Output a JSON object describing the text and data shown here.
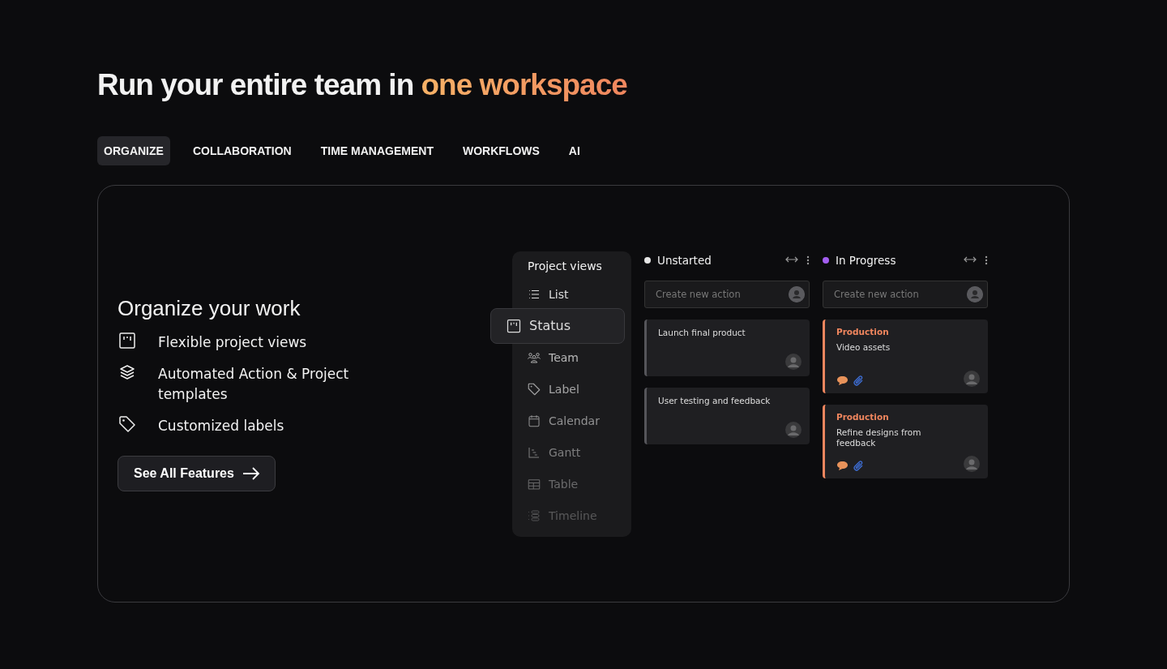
{
  "heading": {
    "text": "Run your entire team in",
    "highlight": "one workspace"
  },
  "tabs": [
    {
      "label": "ORGANIZE",
      "selected": true
    },
    {
      "label": "COLLABORATION",
      "selected": false
    },
    {
      "label": "TIME MANAGEMENT",
      "selected": false
    },
    {
      "label": "WORKFLOWS",
      "selected": false
    },
    {
      "label": "AI",
      "selected": false
    }
  ],
  "feature": {
    "title": "Organize your work",
    "items": [
      {
        "kind": "board",
        "text": "Flexible project views"
      },
      {
        "kind": "layers",
        "text": "Automated Action & Project templates"
      },
      {
        "kind": "tag",
        "text": "Customized labels"
      }
    ],
    "button": "See All Features"
  },
  "project_views": {
    "title": "Project views",
    "items": [
      {
        "kind": "list",
        "label": "List",
        "selected": false
      },
      {
        "kind": "board",
        "label": "Status",
        "selected": true
      },
      {
        "kind": "team",
        "label": "Team",
        "selected": false
      },
      {
        "kind": "tag",
        "label": "Label",
        "selected": false
      },
      {
        "kind": "calendar",
        "label": "Calendar",
        "selected": false
      },
      {
        "kind": "gantt",
        "label": "Gantt",
        "selected": false
      },
      {
        "kind": "table",
        "label": "Table",
        "selected": false
      },
      {
        "kind": "timeline",
        "label": "Timeline",
        "selected": false
      }
    ]
  },
  "columns": [
    {
      "name": "Unstarted",
      "color": "#e6e6e6",
      "placeholder": "Create new action",
      "cards": [
        {
          "title": "Launch final product",
          "color": "#55555a"
        },
        {
          "title": "User testing and feedback",
          "color": "#55555a"
        }
      ]
    },
    {
      "name": "In Progress",
      "color": "#a35ef0",
      "placeholder": "Create new action",
      "cards": [
        {
          "tag": "Production",
          "title": "Video assets",
          "color": "#f0865e"
        },
        {
          "tag": "Production",
          "title": "Refine designs from feedback",
          "color": "#f0865e"
        }
      ]
    }
  ]
}
